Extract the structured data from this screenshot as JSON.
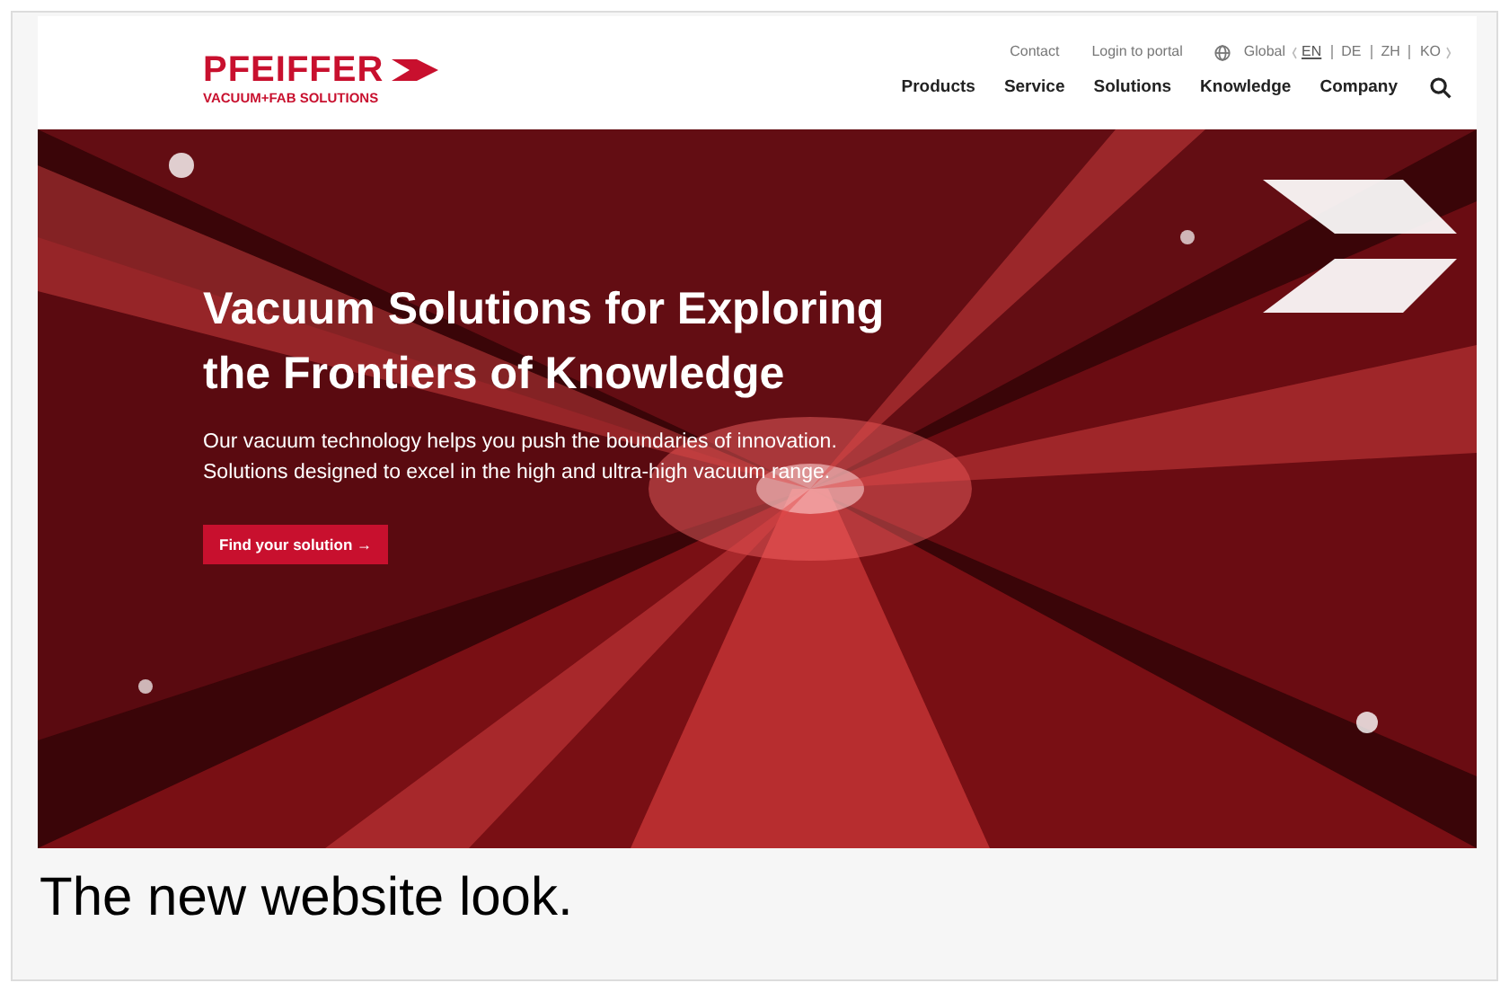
{
  "logo": {
    "name": "PFEIFFER",
    "tagline": "VACUUM+FAB SOLUTIONS"
  },
  "top_links": [
    "Contact",
    "Login to portal"
  ],
  "region": "Global",
  "languages": [
    {
      "label": "EN",
      "selected": true
    },
    {
      "label": "DE",
      "selected": false
    },
    {
      "label": "ZH",
      "selected": false
    },
    {
      "label": "KO",
      "selected": false
    }
  ],
  "nav": [
    "Products",
    "Service",
    "Solutions",
    "Knowledge",
    "Company"
  ],
  "hero": {
    "kind": "picture",
    "title_lines": [
      "Vacuum Solutions for Exploring",
      "the Frontiers of Knowledge"
    ],
    "text_lines": [
      "Our vacuum technology helps you push the boundaries of innovation.",
      "Solutions designed to excel in the high and ultra-high vacuum range."
    ],
    "button": "Find your solution →"
  },
  "caption": "The new website look."
}
